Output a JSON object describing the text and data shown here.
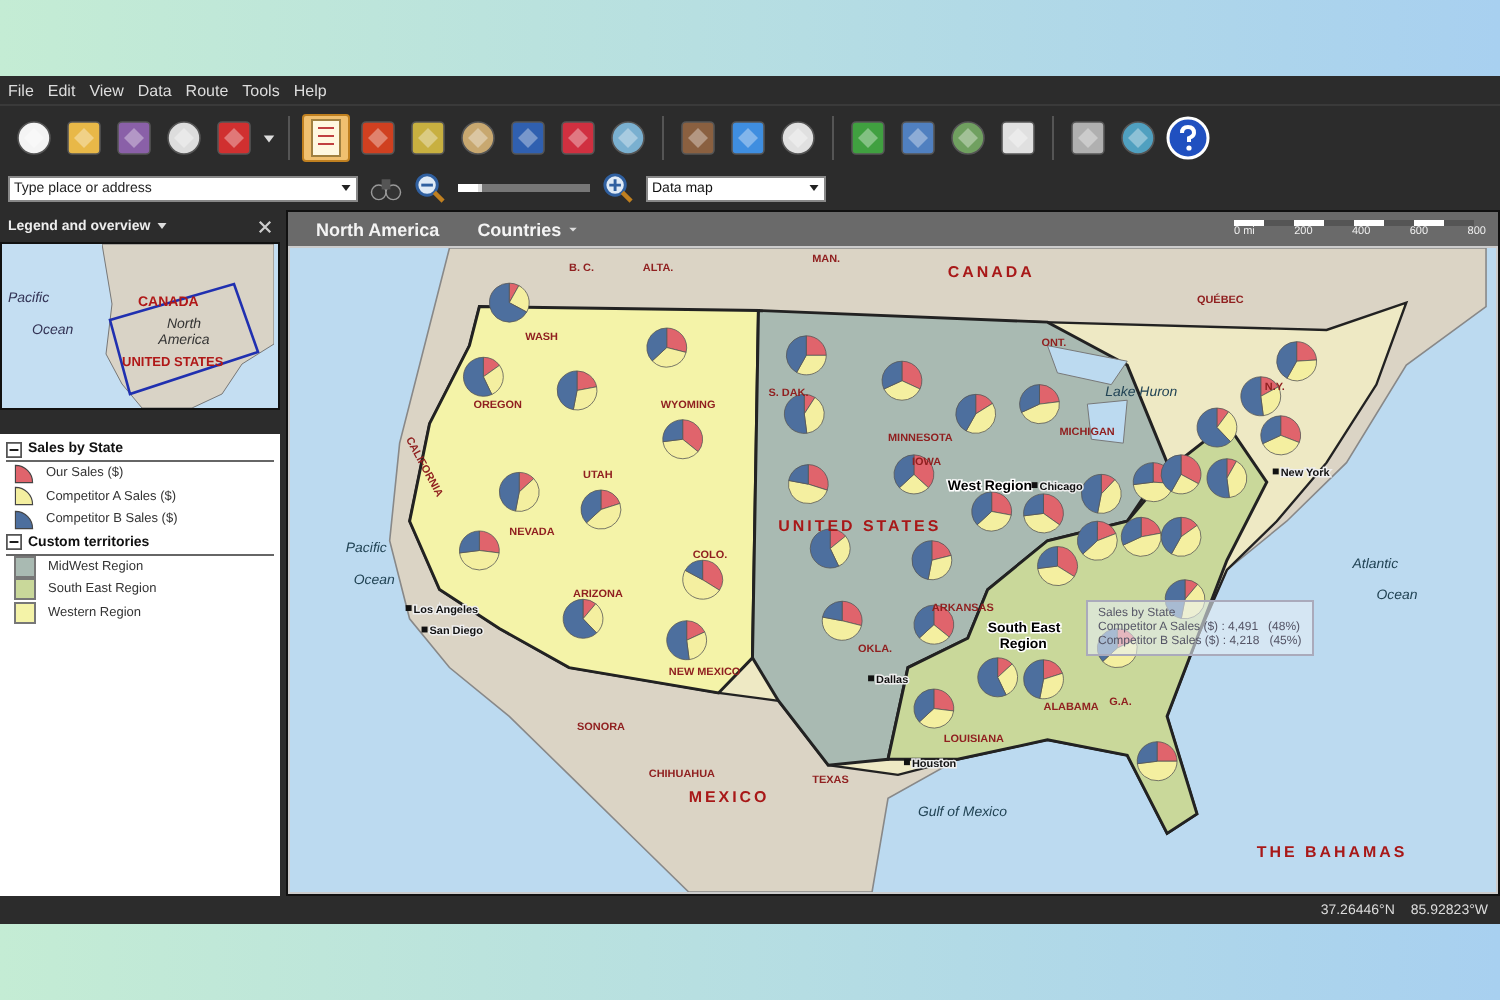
{
  "menu": [
    "File",
    "Edit",
    "View",
    "Data",
    "Route",
    "Tools",
    "Help"
  ],
  "toolbar": {
    "legend_button_on": true
  },
  "search": {
    "placeholder": "Type place or address"
  },
  "zoom": {
    "level": 0.15
  },
  "map_style": {
    "value": "Data map"
  },
  "legend_panel": {
    "title": "Legend and overview",
    "overview_labels": [
      "Pacific",
      "Ocean",
      "CANADA",
      "North America",
      "UNITED STATES"
    ],
    "groups": [
      {
        "title": "Sales by State",
        "expanded": true,
        "items": [
          {
            "label": "Our Sales ($)",
            "color": "#e0646c"
          },
          {
            "label": "Competitor A Sales ($)",
            "color": "#f4efa0"
          },
          {
            "label": "Competitor B Sales ($)",
            "color": "#4d6f9e"
          }
        ]
      },
      {
        "title": "Custom territories",
        "expanded": true,
        "items": [
          {
            "label": "MidWest Region",
            "color": "#a9bab2"
          },
          {
            "label": "South East Region",
            "color": "#c9d89a"
          },
          {
            "label": "Western Region",
            "color": "#f4f3a8"
          }
        ]
      }
    ]
  },
  "map": {
    "title": "North America",
    "layer": "Countries",
    "scale_labels": [
      "0 mi",
      "200",
      "400",
      "600",
      "800"
    ],
    "labels": [
      {
        "text": "B. C.",
        "kind": "province"
      },
      {
        "text": "ALTA.",
        "kind": "province"
      },
      {
        "text": "MAN.",
        "kind": "province"
      },
      {
        "text": "CANADA",
        "kind": "country"
      },
      {
        "text": "QUÉBEC",
        "kind": "province"
      },
      {
        "text": "ONT.",
        "kind": "province"
      },
      {
        "text": "Lake Huron",
        "kind": "water"
      },
      {
        "text": "N.Y.",
        "kind": "state"
      },
      {
        "text": "WASH",
        "kind": "state"
      },
      {
        "text": "OREGON",
        "kind": "state"
      },
      {
        "text": "WYOMING",
        "kind": "state"
      },
      {
        "text": "S. DAK.",
        "kind": "state"
      },
      {
        "text": "MINNESOTA",
        "kind": "state"
      },
      {
        "text": "MICHIGAN",
        "kind": "state"
      },
      {
        "text": "IOWA",
        "kind": "state"
      },
      {
        "text": "West Region",
        "kind": "region"
      },
      {
        "text": "Chicago",
        "kind": "city"
      },
      {
        "text": "New York",
        "kind": "city"
      },
      {
        "text": "UTAH",
        "kind": "state"
      },
      {
        "text": "NEVADA",
        "kind": "state"
      },
      {
        "text": "CALIFORNIA",
        "kind": "state"
      },
      {
        "text": "UNITED STATES",
        "kind": "country"
      },
      {
        "text": "COLO.",
        "kind": "state"
      },
      {
        "text": "Pacific",
        "kind": "water"
      },
      {
        "text": "Ocean",
        "kind": "water"
      },
      {
        "text": "Atlantic",
        "kind": "water"
      },
      {
        "text": "Ocean",
        "kind": "water"
      },
      {
        "text": "ARKANSAS",
        "kind": "state"
      },
      {
        "text": "Los Angeles",
        "kind": "city"
      },
      {
        "text": "San Diego",
        "kind": "city"
      },
      {
        "text": "ARIZONA",
        "kind": "state"
      },
      {
        "text": "OKLA.",
        "kind": "state"
      },
      {
        "text": "South East Region",
        "kind": "region"
      },
      {
        "text": "NEW MEXICO",
        "kind": "state"
      },
      {
        "text": "Dallas",
        "kind": "city"
      },
      {
        "text": "ALABAMA",
        "kind": "state"
      },
      {
        "text": "G.A.",
        "kind": "state"
      },
      {
        "text": "SONORA",
        "kind": "state"
      },
      {
        "text": "LOUISIANA",
        "kind": "state"
      },
      {
        "text": "Houston",
        "kind": "city"
      },
      {
        "text": "TEXAS",
        "kind": "state"
      },
      {
        "text": "CHIHUAHUA",
        "kind": "state"
      },
      {
        "text": "MEXICO",
        "kind": "country"
      },
      {
        "text": "Gulf of Mexico",
        "kind": "water"
      },
      {
        "text": "THE BAHAMAS",
        "kind": "country"
      }
    ],
    "tooltip": {
      "title": "Sales by State",
      "lines": [
        "Competitor A Sales ($) : 4,491   (48%)",
        "Competitor B Sales ($) : 4,218   (45%)"
      ]
    }
  },
  "status_bar": {
    "latitude": "37.26446°N",
    "longitude": "85.92823°W"
  }
}
